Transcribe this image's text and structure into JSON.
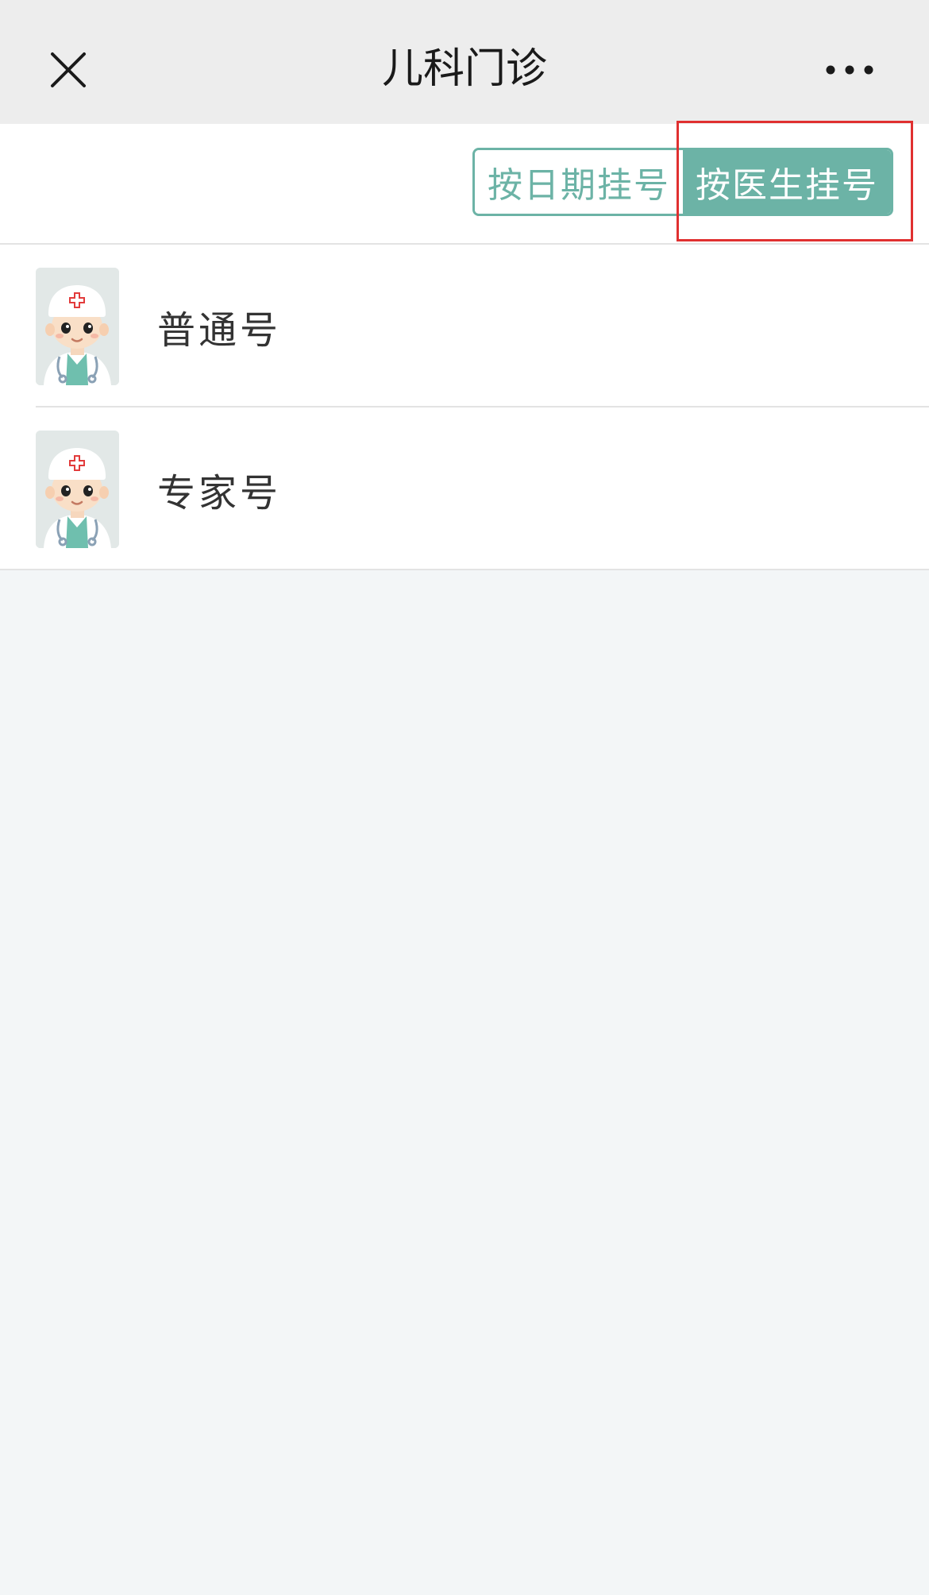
{
  "navbar": {
    "title": "儿科门诊",
    "close_icon": "close-icon",
    "more_icon": "more-dots-icon"
  },
  "toolbar": {
    "by_date_label": "按日期挂号",
    "by_doctor_label": "按医生挂号",
    "active_tab": "by_doctor"
  },
  "list": {
    "items": [
      {
        "label": "普通号",
        "icon": "doctor-avatar-icon"
      },
      {
        "label": "专家号",
        "icon": "doctor-avatar-icon"
      }
    ]
  },
  "colors": {
    "accent": "#6cb3a6",
    "highlight": "#e03030",
    "navbar_bg": "#ededed",
    "page_bg": "#f3f6f7"
  }
}
